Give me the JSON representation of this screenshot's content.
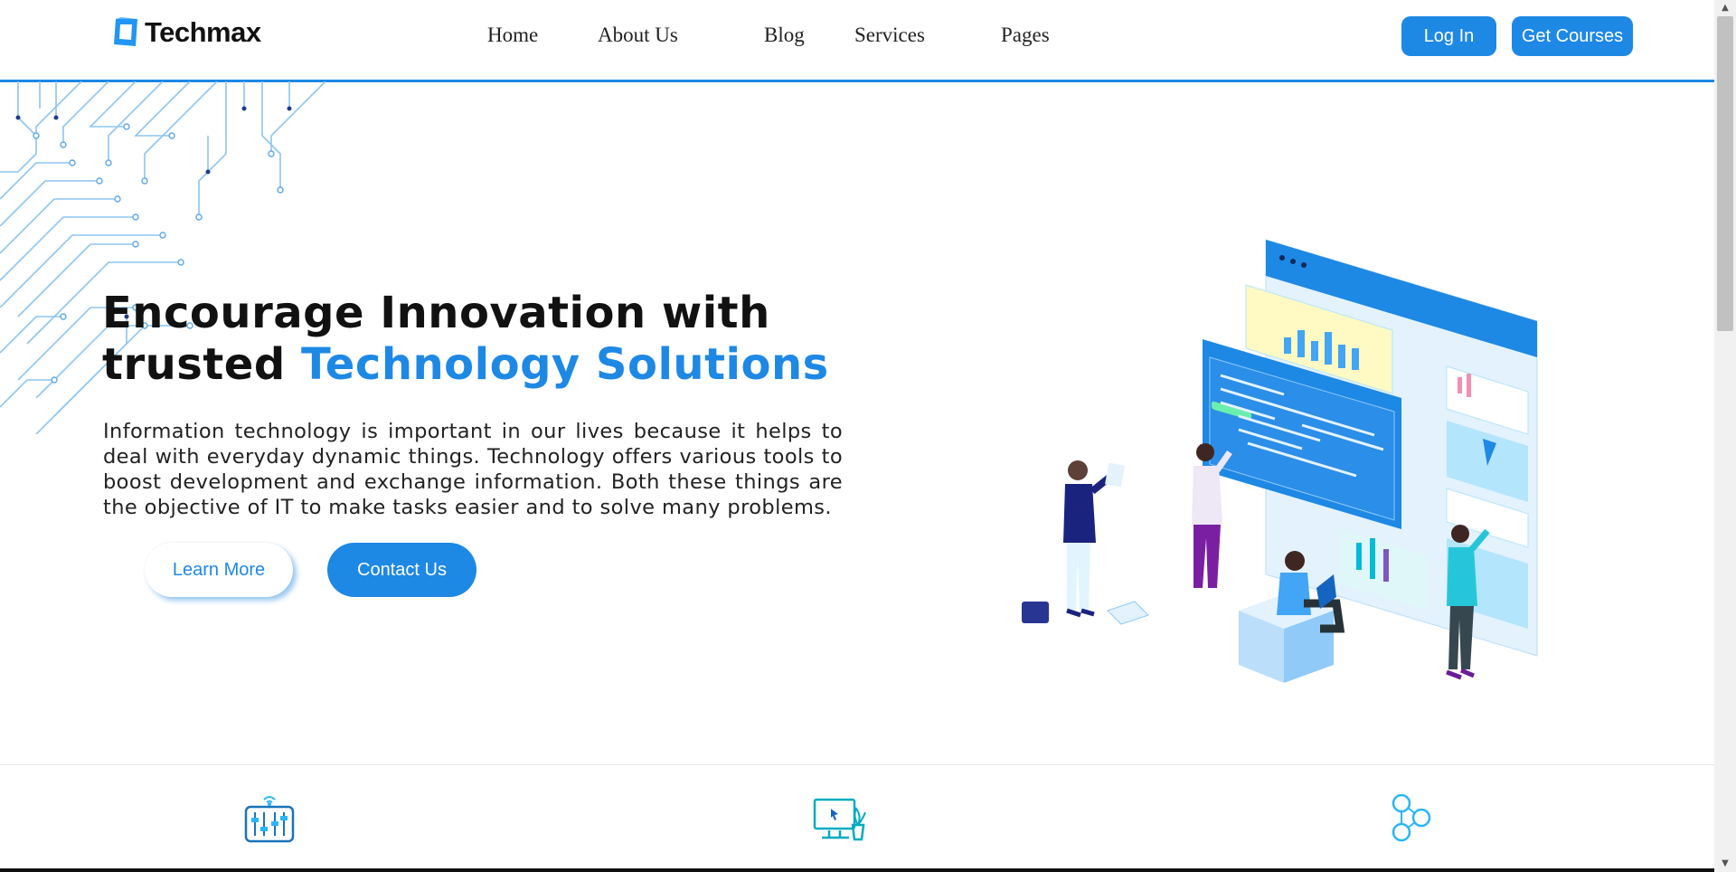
{
  "brand": {
    "name": "Techmax",
    "accent_color": "#1e88e5"
  },
  "nav": {
    "items": [
      {
        "label": "Home"
      },
      {
        "label": "About Us"
      },
      {
        "label": "Blog"
      },
      {
        "label": "Services"
      },
      {
        "label": "Pages"
      }
    ],
    "login_label": "Log In",
    "courses_label": "Get Courses"
  },
  "hero": {
    "title_line1": "Encourage Innovation with",
    "title_line2_prefix": "trusted ",
    "title_line2_accent": "Technology Solutions",
    "description": "Information technology is important in our lives because it helps to deal with everyday dynamic things. Technology offers various tools to boost development and exchange information. Both these things are the objective of IT to make tasks easier and to solve many problems.",
    "learn_more_label": "Learn More",
    "contact_label": "Contact Us"
  },
  "features": {
    "icons": [
      "control-panel-icon",
      "desktop-plant-icon",
      "molecule-icon"
    ]
  }
}
